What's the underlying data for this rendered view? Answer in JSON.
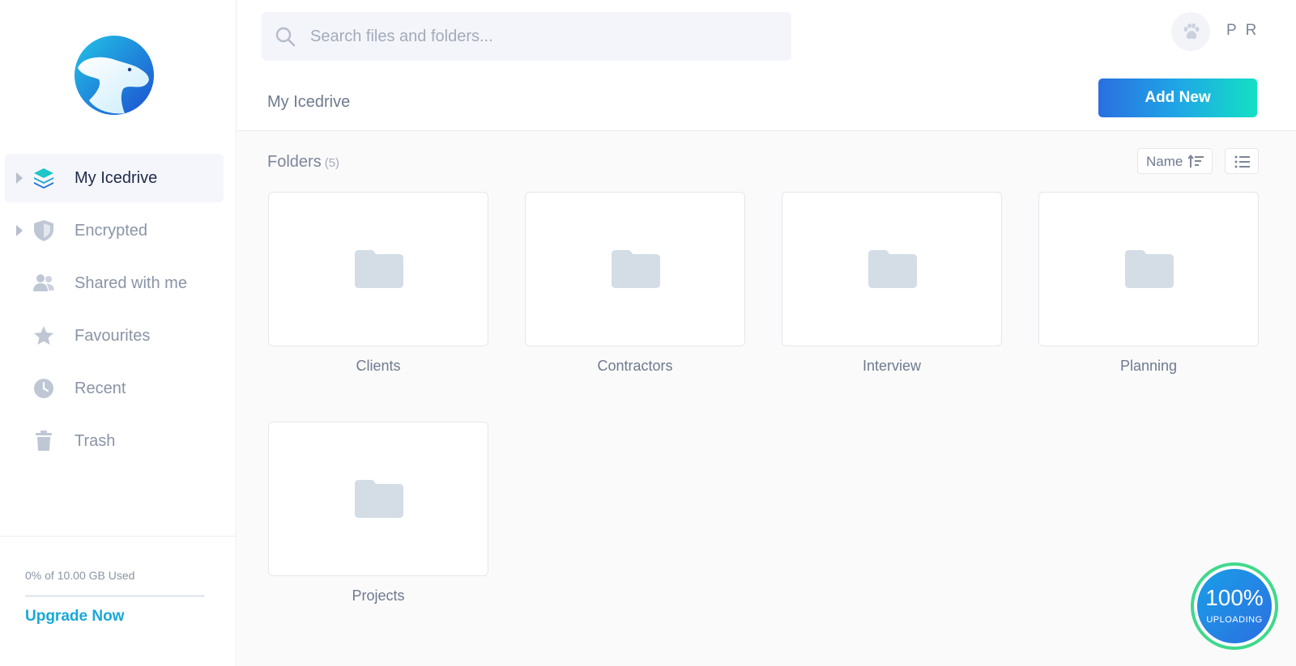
{
  "sidebar": {
    "items": [
      {
        "label": "My Icedrive",
        "icon": "layers-icon",
        "active": true,
        "expandable": true
      },
      {
        "label": "Encrypted",
        "icon": "shield-icon",
        "active": false,
        "expandable": true
      },
      {
        "label": "Shared with me",
        "icon": "users-icon",
        "active": false,
        "expandable": false
      },
      {
        "label": "Favourites",
        "icon": "star-icon",
        "active": false,
        "expandable": false
      },
      {
        "label": "Recent",
        "icon": "clock-icon",
        "active": false,
        "expandable": false
      },
      {
        "label": "Trash",
        "icon": "trash-icon",
        "active": false,
        "expandable": false
      }
    ],
    "storage": {
      "text": "0% of 10.00 GB Used",
      "used_fraction": 0.0
    },
    "upgrade_label": "Upgrade Now"
  },
  "header": {
    "search_placeholder": "Search files and folders...",
    "search_value": "",
    "user_initials": "P R",
    "avatar_icon": "paw-icon"
  },
  "toolbar": {
    "breadcrumb": "My Icedrive",
    "add_new_label": "Add New"
  },
  "content": {
    "folders_title": "Folders",
    "folders_count": "(5)",
    "sort_label": "Name",
    "sort_icon": "sort-ascending-icon",
    "view_icon": "list-view-icon",
    "folders": [
      "Clients",
      "Contractors",
      "Interview",
      "Planning",
      "Projects"
    ]
  },
  "upload": {
    "percent": "100%",
    "label": "UPLOADING"
  },
  "colors": {
    "accent": "#17a9d9",
    "active_text": "#1e2a4a",
    "folder_icon": "#d4dde6",
    "upload_ring": "#3fd98c"
  }
}
